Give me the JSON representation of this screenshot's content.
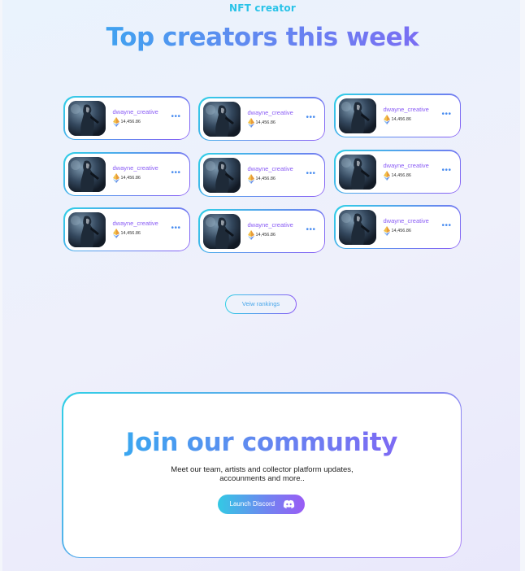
{
  "header": {
    "section_label": "NFT creator",
    "title": "Top creators this week"
  },
  "creators": [
    {
      "name": "dwayne_creative",
      "value": "14,456.86",
      "currency_icon": "ethereum-icon",
      "menu_icon": "more-dots-icon"
    },
    {
      "name": "dwayne_creative",
      "value": "14,456.86",
      "currency_icon": "ethereum-icon",
      "menu_icon": "more-dots-icon"
    },
    {
      "name": "dwayne_creative",
      "value": "14,456.86",
      "currency_icon": "ethereum-icon",
      "menu_icon": "more-dots-icon"
    },
    {
      "name": "dwayne_creative",
      "value": "14,456.86",
      "currency_icon": "ethereum-icon",
      "menu_icon": "more-dots-icon"
    },
    {
      "name": "dwayne_creative",
      "value": "14,456.86",
      "currency_icon": "ethereum-icon",
      "menu_icon": "more-dots-icon"
    },
    {
      "name": "dwayne_creative",
      "value": "14,456.86",
      "currency_icon": "ethereum-icon",
      "menu_icon": "more-dots-icon"
    },
    {
      "name": "dwayne_creative",
      "value": "14,456.86",
      "currency_icon": "ethereum-icon",
      "menu_icon": "more-dots-icon"
    },
    {
      "name": "dwayne_creative",
      "value": "14,456.86",
      "currency_icon": "ethereum-icon",
      "menu_icon": "more-dots-icon"
    },
    {
      "name": "dwayne_creative",
      "value": "14,456.86",
      "currency_icon": "ethereum-icon",
      "menu_icon": "more-dots-icon"
    }
  ],
  "rankings": {
    "button_label": "Veiw rankings"
  },
  "community": {
    "title": "Join our community",
    "description": "Meet our team, artists and collector platform updates, accounments and more..",
    "button_label": "Launch Discord",
    "button_icon": "discord-icon"
  },
  "colors": {
    "accent_cyan": "#29c3e8",
    "accent_blue": "#5e8cf0",
    "accent_purple": "#8a5cf5",
    "background": "#eef0fb"
  }
}
